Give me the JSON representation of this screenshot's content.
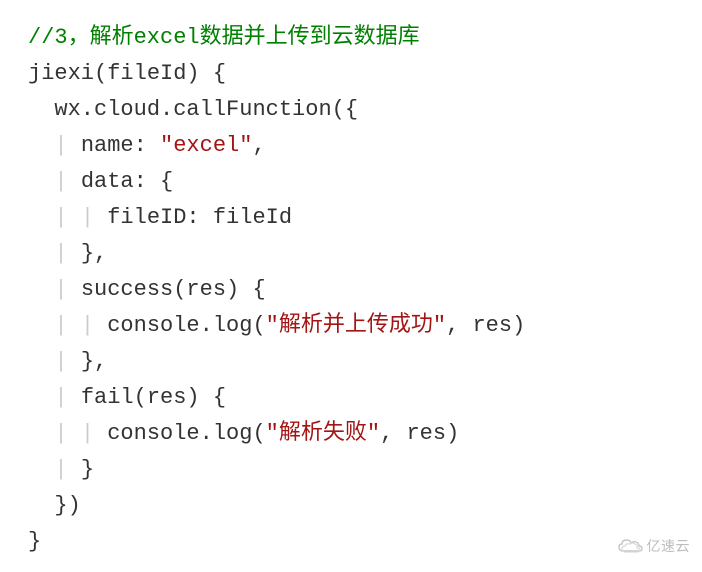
{
  "code": {
    "lines": [
      {
        "indent": 0,
        "segments": [
          {
            "cls": "comment",
            "t": "//3，解析excel数据并上传到云数据库"
          }
        ]
      },
      {
        "indent": 0,
        "segments": [
          {
            "cls": "plain",
            "t": "jiexi(fileId) {"
          }
        ]
      },
      {
        "indent": 1,
        "segments": [
          {
            "cls": "plain",
            "t": "wx.cloud.callFunction({"
          }
        ]
      },
      {
        "indent": 2,
        "segments": [
          {
            "cls": "plain",
            "t": "name: "
          },
          {
            "cls": "string",
            "t": "\"excel\""
          },
          {
            "cls": "plain",
            "t": ","
          }
        ]
      },
      {
        "indent": 2,
        "segments": [
          {
            "cls": "plain",
            "t": "data: {"
          }
        ]
      },
      {
        "indent": 3,
        "segments": [
          {
            "cls": "plain",
            "t": "fileID: fileId"
          }
        ]
      },
      {
        "indent": 2,
        "segments": [
          {
            "cls": "plain",
            "t": "},"
          }
        ]
      },
      {
        "indent": 2,
        "segments": [
          {
            "cls": "plain",
            "t": "success(res) {"
          }
        ]
      },
      {
        "indent": 3,
        "segments": [
          {
            "cls": "plain",
            "t": "console.log("
          },
          {
            "cls": "string",
            "t": "\"解析并上传成功\""
          },
          {
            "cls": "plain",
            "t": ", res)"
          }
        ]
      },
      {
        "indent": 2,
        "segments": [
          {
            "cls": "plain",
            "t": "},"
          }
        ]
      },
      {
        "indent": 2,
        "segments": [
          {
            "cls": "plain",
            "t": "fail(res) {"
          }
        ]
      },
      {
        "indent": 3,
        "segments": [
          {
            "cls": "plain",
            "t": "console.log("
          },
          {
            "cls": "string",
            "t": "\"解析失败\""
          },
          {
            "cls": "plain",
            "t": ", res)"
          }
        ]
      },
      {
        "indent": 2,
        "segments": [
          {
            "cls": "plain",
            "t": "}"
          }
        ]
      },
      {
        "indent": 1,
        "segments": [
          {
            "cls": "plain",
            "t": "})"
          }
        ]
      },
      {
        "indent": 0,
        "segments": [
          {
            "cls": "plain",
            "t": "}"
          }
        ]
      }
    ],
    "indent_unit": "  ",
    "guide_char": "|",
    "guide_prefix": " "
  },
  "watermark": {
    "text": "亿速云"
  }
}
